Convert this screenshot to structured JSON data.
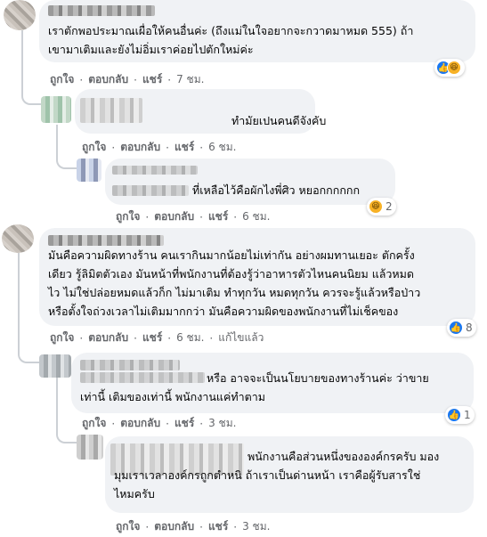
{
  "comments": [
    {
      "text_lines": [
        "เราตักพอประมาณเผื่อให้คนอื่นค่ะ (ถึงแม่ในใจอยากจะกวาดมาหมด 555) ถ้า",
        "เขามาเติมและยังไม่อิ่มเราค่อยไปตักใหม่ค่ะ"
      ],
      "actions": {
        "like": "ถูกใจ",
        "reply": "ตอบกลับ",
        "share": "แชร์",
        "time": "7 ชม."
      },
      "reactions": {
        "icons": [
          "like-icon",
          "haha-icon"
        ],
        "count": ""
      }
    },
    {
      "text_lines": [
        "ทำมัยเปนคนดีจังคับ"
      ],
      "actions": {
        "like": "ถูกใจ",
        "reply": "ตอบกลับ",
        "share": "แชร์",
        "time": "6 ชม."
      }
    },
    {
      "text_lines": [
        "ที่เหลือไว้คือผักไงพี่ศิว หยอกกกกกก"
      ],
      "actions": {
        "like": "ถูกใจ",
        "reply": "ตอบกลับ",
        "share": "แชร์",
        "time": "6 ชม."
      },
      "reactions": {
        "icons": [
          "haha-icon"
        ],
        "count": "2"
      }
    },
    {
      "text_lines": [
        "มันคือความผิดทางร้าน คนเรากินมากน้อยไม่เท่ากัน อย่างผมทานเยอะ ตักครั้ง",
        "เดียว รู้ลิมิตตัวเอง มันหน้าที่พนักงานที่ต้องรู้ว่าอาหารตัวไหนคนนิยม แล้วหมด",
        "ไว ไม่ใช่ปล่อยหมดแล้วก็ก ไม่มาเติม ทำทุกวัน หมดทุกวัน ควรจะรู้แล้วหรือป่าว",
        "หรือตั้งใจถ่วงเวลาไม่เติมมากกว่า มันคือความผิดของพนักงานที่ไม่เช็คของ"
      ],
      "actions": {
        "like": "ถูกใจ",
        "reply": "ตอบกลับ",
        "share": "แชร์",
        "time": "6 ชม.",
        "edited": "แก้ไขแล้ว"
      },
      "reactions": {
        "icons": [
          "like-icon"
        ],
        "count": "8"
      }
    },
    {
      "text_lines": [
        "หรือ อาจจะเป็นนโยบายของทางร้านค่ะ ว่าขาย",
        "เท่านี้ เติมของเท่านี้ พนักงานแค่ทำตาม"
      ],
      "actions": {
        "like": "ถูกใจ",
        "reply": "ตอบกลับ",
        "share": "แชร์",
        "time": "3 ชม."
      },
      "reactions": {
        "icons": [
          "like-icon"
        ],
        "count": "1"
      }
    },
    {
      "text_lines": [
        "พนักงานคือส่วนหนึ่งขององค์กรครับ มอง",
        "มุมเราเวลาองค์กรถูกตำหนิ ถ้าเราเป็นด่านหน้า เราคือผู้รับสารใช่",
        "ไหมครับ"
      ],
      "actions": {
        "like": "ถูกใจ",
        "reply": "ตอบกลับ",
        "share": "แชร์",
        "time": "3 ชม."
      }
    }
  ],
  "colors": {
    "like": "#1877f2",
    "haha": "#f7b125",
    "bubble": "#f0f2f5",
    "meta": "#65676b"
  }
}
